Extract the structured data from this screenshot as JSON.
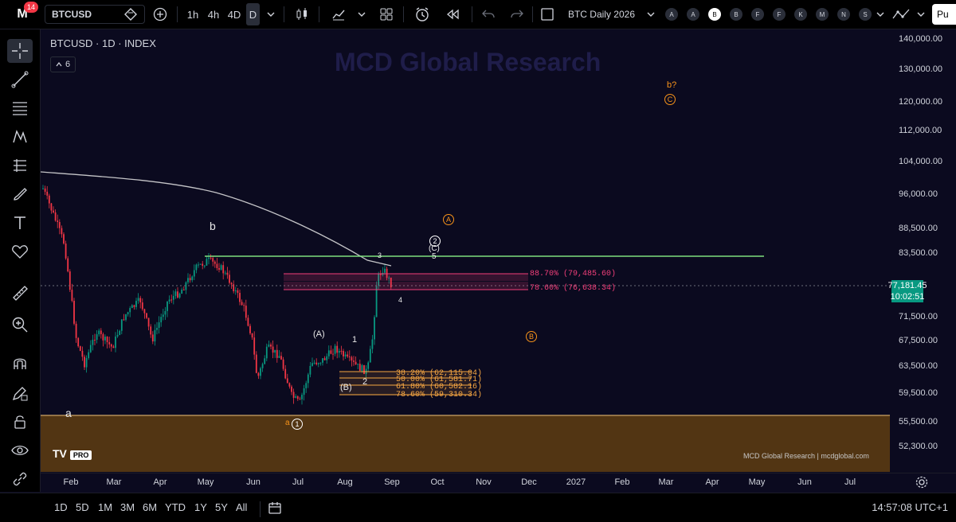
{
  "topbar": {
    "notification_count": "14",
    "symbol": "BTCUSD",
    "timeframes": [
      "1h",
      "4h",
      "4D",
      "D"
    ],
    "layout_name": "BTC Daily 2026",
    "layout_letters": [
      "A",
      "A",
      "B",
      "B",
      "F",
      "F",
      "K",
      "M",
      "N",
      "S"
    ],
    "publish_label": "Pu"
  },
  "legend": {
    "title": "BTCUSD · 1D · INDEX",
    "indicator_count": "6"
  },
  "watermark": "MCD Global Research",
  "price_axis": [
    "140,000.00",
    "130,000.00",
    "120,000.00",
    "112,000.00",
    "104,000.00",
    "96,000.00",
    "88,500.00",
    "83,500.00",
    "71,500.00",
    "67,500.00",
    "63,500.00",
    "59,500.00",
    "55,500.00",
    "52,300.00"
  ],
  "current_price": "77,181.45",
  "countdown": "10:02:51",
  "time_axis": [
    "Feb",
    "Mar",
    "Apr",
    "May",
    "Jun",
    "Jul",
    "Aug",
    "Sep",
    "Oct",
    "Nov",
    "Dec",
    "2027",
    "Feb",
    "Mar",
    "Apr",
    "May",
    "Jun",
    "Jul"
  ],
  "fib_pink": [
    "88.70% (79,485.60)",
    "78.60% (76,638.34)"
  ],
  "fib_orange": [
    "38.20% (62,115.04)",
    "50.00% (61,581.71)",
    "61.80% (60,582.16)",
    "78.60% (59,310.34)"
  ],
  "wave_labels": {
    "b": "b",
    "a": "a",
    "A_paren": "(A)",
    "B_paren": "(B)",
    "C_paren": "(C)",
    "one": "1",
    "two": "2",
    "three": "3",
    "four": "4",
    "five": "5",
    "circle_two": "2",
    "circle_one": "1",
    "circle_A": "A",
    "circle_B": "B",
    "circle_C": "C",
    "b_question": "b?",
    "small_a": "a"
  },
  "tv_logo": "TV",
  "tv_pro": "PRO",
  "credit": "MCD Global Research | mcdglobal.com",
  "bottombar": {
    "ranges": [
      "1D",
      "5D",
      "1M",
      "3M",
      "6M",
      "YTD",
      "1Y",
      "5Y",
      "All"
    ],
    "clock": "14:57:08 UTC+1"
  },
  "colors": {
    "background": "#0b0a1f",
    "bull": "#089981",
    "bear": "#f23645",
    "fib_pink": "#f23f7a",
    "fib_orange": "#f7a742",
    "wave_orange": "#f7931a",
    "support_zone": "#5a3a12",
    "resistance_line": "#7ee07e",
    "moving_average": "#e6e6e6"
  }
}
